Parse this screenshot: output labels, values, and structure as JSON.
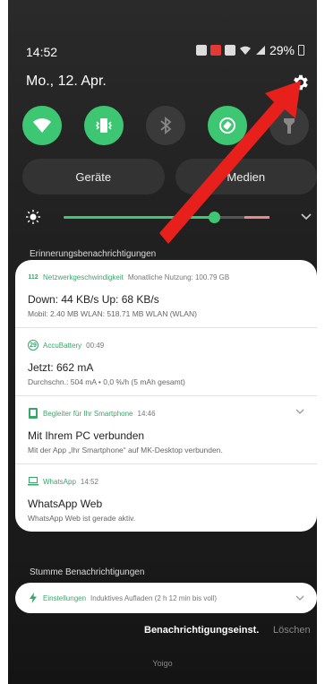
{
  "status_bar": {
    "time": "14:52",
    "battery": "29%"
  },
  "header": {
    "date": "Mo., 12. Apr."
  },
  "quick_settings": {
    "toggles": [
      {
        "icon": "wifi-icon",
        "state": "on"
      },
      {
        "icon": "mute-vibrate-icon",
        "state": "on"
      },
      {
        "icon": "bluetooth-icon",
        "state": "off"
      },
      {
        "icon": "auto-rotate-icon",
        "state": "on"
      },
      {
        "icon": "torch-icon",
        "state": "off"
      }
    ],
    "devices_label": "Geräte",
    "media_label": "Medien",
    "brightness_level": 0.73
  },
  "sections": {
    "reminders_label": "Erinnerungsbenachrichtigungen",
    "silent_label": "Stumme Benachrichtigungen"
  },
  "notifications": [
    {
      "app": "Netzwerkgeschwindigkeit",
      "meta": "Monatliche Nutzung: 100.79 GB",
      "title": "Down: 44 KB/s  Up: 68 KB/s",
      "text": "Mobil: 2.40 MB  WLAN: 518.71 MB  WLAN (WLAN)"
    },
    {
      "app": "AccuBattery",
      "meta": "00:49",
      "title": "Jetzt: 662 mA",
      "text": "Durchschn.: 504 mA • 0,0 %/h (5 mAh gesamt)"
    },
    {
      "app": "Begleiter für Ihr Smartphone",
      "meta": "14:46",
      "title": "Mit Ihrem PC verbunden",
      "text": "Mit der App „Ihr Smartphone“ auf MK-Desktop verbunden."
    },
    {
      "app": "WhatsApp",
      "meta": "14:52",
      "title": "WhatsApp Web",
      "text": "WhatsApp Web ist gerade aktiv."
    }
  ],
  "silent_notification": {
    "app": "Einstellungen",
    "meta": "Induktives Aufladen (2 h 12 min bis voll)"
  },
  "footer": {
    "settings_label": "Benachrichtigungseinst.",
    "clear_label": "Löschen",
    "carrier": "Yoigo"
  },
  "colors": {
    "accent": "#3ec773",
    "arrow": "#e8201c"
  }
}
